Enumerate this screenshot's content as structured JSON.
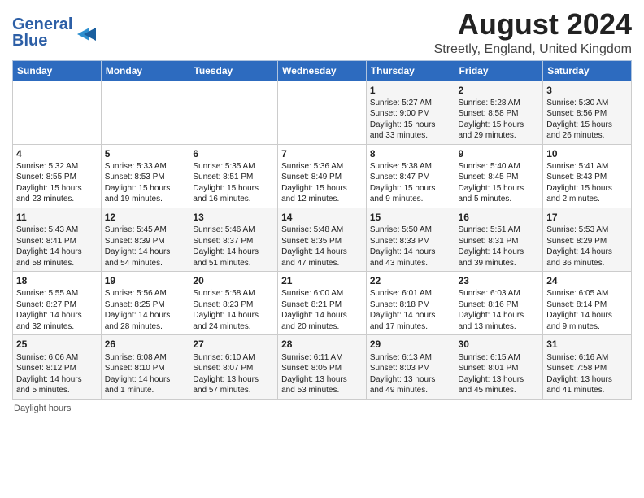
{
  "header": {
    "logo_line1": "General",
    "logo_line2": "Blue",
    "title": "August 2024",
    "subtitle": "Streetly, England, United Kingdom"
  },
  "days_of_week": [
    "Sunday",
    "Monday",
    "Tuesday",
    "Wednesday",
    "Thursday",
    "Friday",
    "Saturday"
  ],
  "weeks": [
    [
      {
        "day": "",
        "text": ""
      },
      {
        "day": "",
        "text": ""
      },
      {
        "day": "",
        "text": ""
      },
      {
        "day": "",
        "text": ""
      },
      {
        "day": "1",
        "text": "Sunrise: 5:27 AM\nSunset: 9:00 PM\nDaylight: 15 hours\nand 33 minutes."
      },
      {
        "day": "2",
        "text": "Sunrise: 5:28 AM\nSunset: 8:58 PM\nDaylight: 15 hours\nand 29 minutes."
      },
      {
        "day": "3",
        "text": "Sunrise: 5:30 AM\nSunset: 8:56 PM\nDaylight: 15 hours\nand 26 minutes."
      }
    ],
    [
      {
        "day": "4",
        "text": "Sunrise: 5:32 AM\nSunset: 8:55 PM\nDaylight: 15 hours\nand 23 minutes."
      },
      {
        "day": "5",
        "text": "Sunrise: 5:33 AM\nSunset: 8:53 PM\nDaylight: 15 hours\nand 19 minutes."
      },
      {
        "day": "6",
        "text": "Sunrise: 5:35 AM\nSunset: 8:51 PM\nDaylight: 15 hours\nand 16 minutes."
      },
      {
        "day": "7",
        "text": "Sunrise: 5:36 AM\nSunset: 8:49 PM\nDaylight: 15 hours\nand 12 minutes."
      },
      {
        "day": "8",
        "text": "Sunrise: 5:38 AM\nSunset: 8:47 PM\nDaylight: 15 hours\nand 9 minutes."
      },
      {
        "day": "9",
        "text": "Sunrise: 5:40 AM\nSunset: 8:45 PM\nDaylight: 15 hours\nand 5 minutes."
      },
      {
        "day": "10",
        "text": "Sunrise: 5:41 AM\nSunset: 8:43 PM\nDaylight: 15 hours\nand 2 minutes."
      }
    ],
    [
      {
        "day": "11",
        "text": "Sunrise: 5:43 AM\nSunset: 8:41 PM\nDaylight: 14 hours\nand 58 minutes."
      },
      {
        "day": "12",
        "text": "Sunrise: 5:45 AM\nSunset: 8:39 PM\nDaylight: 14 hours\nand 54 minutes."
      },
      {
        "day": "13",
        "text": "Sunrise: 5:46 AM\nSunset: 8:37 PM\nDaylight: 14 hours\nand 51 minutes."
      },
      {
        "day": "14",
        "text": "Sunrise: 5:48 AM\nSunset: 8:35 PM\nDaylight: 14 hours\nand 47 minutes."
      },
      {
        "day": "15",
        "text": "Sunrise: 5:50 AM\nSunset: 8:33 PM\nDaylight: 14 hours\nand 43 minutes."
      },
      {
        "day": "16",
        "text": "Sunrise: 5:51 AM\nSunset: 8:31 PM\nDaylight: 14 hours\nand 39 minutes."
      },
      {
        "day": "17",
        "text": "Sunrise: 5:53 AM\nSunset: 8:29 PM\nDaylight: 14 hours\nand 36 minutes."
      }
    ],
    [
      {
        "day": "18",
        "text": "Sunrise: 5:55 AM\nSunset: 8:27 PM\nDaylight: 14 hours\nand 32 minutes."
      },
      {
        "day": "19",
        "text": "Sunrise: 5:56 AM\nSunset: 8:25 PM\nDaylight: 14 hours\nand 28 minutes."
      },
      {
        "day": "20",
        "text": "Sunrise: 5:58 AM\nSunset: 8:23 PM\nDaylight: 14 hours\nand 24 minutes."
      },
      {
        "day": "21",
        "text": "Sunrise: 6:00 AM\nSunset: 8:21 PM\nDaylight: 14 hours\nand 20 minutes."
      },
      {
        "day": "22",
        "text": "Sunrise: 6:01 AM\nSunset: 8:18 PM\nDaylight: 14 hours\nand 17 minutes."
      },
      {
        "day": "23",
        "text": "Sunrise: 6:03 AM\nSunset: 8:16 PM\nDaylight: 14 hours\nand 13 minutes."
      },
      {
        "day": "24",
        "text": "Sunrise: 6:05 AM\nSunset: 8:14 PM\nDaylight: 14 hours\nand 9 minutes."
      }
    ],
    [
      {
        "day": "25",
        "text": "Sunrise: 6:06 AM\nSunset: 8:12 PM\nDaylight: 14 hours\nand 5 minutes."
      },
      {
        "day": "26",
        "text": "Sunrise: 6:08 AM\nSunset: 8:10 PM\nDaylight: 14 hours\nand 1 minute."
      },
      {
        "day": "27",
        "text": "Sunrise: 6:10 AM\nSunset: 8:07 PM\nDaylight: 13 hours\nand 57 minutes."
      },
      {
        "day": "28",
        "text": "Sunrise: 6:11 AM\nSunset: 8:05 PM\nDaylight: 13 hours\nand 53 minutes."
      },
      {
        "day": "29",
        "text": "Sunrise: 6:13 AM\nSunset: 8:03 PM\nDaylight: 13 hours\nand 49 minutes."
      },
      {
        "day": "30",
        "text": "Sunrise: 6:15 AM\nSunset: 8:01 PM\nDaylight: 13 hours\nand 45 minutes."
      },
      {
        "day": "31",
        "text": "Sunrise: 6:16 AM\nSunset: 7:58 PM\nDaylight: 13 hours\nand 41 minutes."
      }
    ]
  ],
  "footer": "Daylight hours"
}
